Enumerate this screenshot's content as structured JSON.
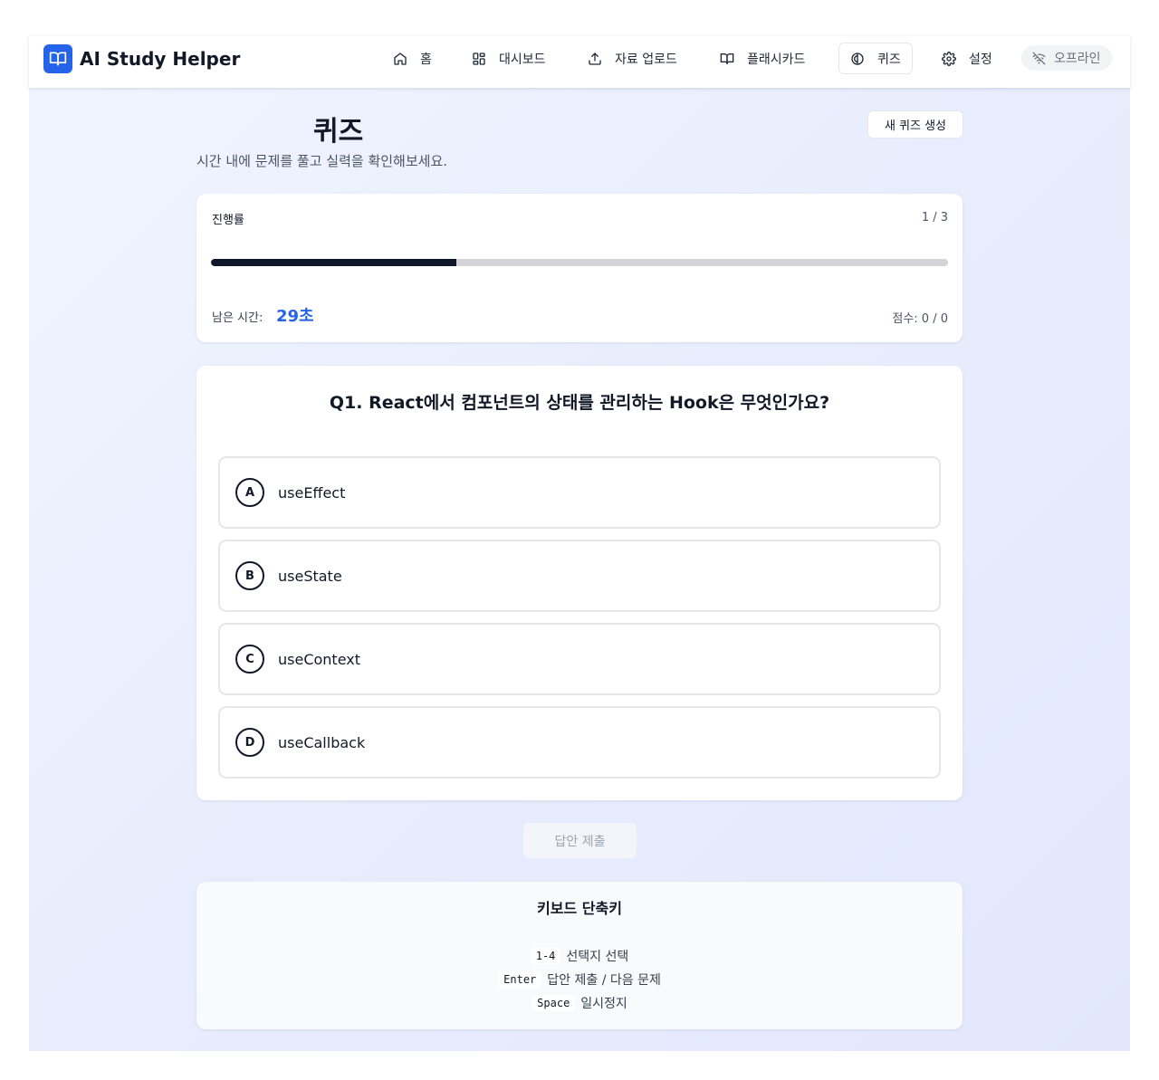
{
  "header": {
    "app_name": "AI Study Helper",
    "nav": [
      {
        "label": "홈",
        "icon": "home-icon"
      },
      {
        "label": "대시보드",
        "icon": "dashboard-grid-icon"
      },
      {
        "label": "자료 업로드",
        "icon": "upload-icon"
      },
      {
        "label": "플래시카드",
        "icon": "book-open-icon"
      },
      {
        "label": "퀴즈",
        "icon": "quiz-icon",
        "active": true
      },
      {
        "label": "설정",
        "icon": "gear-icon"
      }
    ],
    "status_label": "오프라인",
    "status_icon": "wifi-off-icon"
  },
  "page": {
    "title": "퀴즈",
    "subtitle": "시간 내에 문제를 풀고 실력을 확인해보세요.",
    "new_quiz_button": "새 퀴즈 생성"
  },
  "progress": {
    "label": "진행률",
    "count": "1 / 3",
    "fraction": 0.333,
    "time_label": "남은 시간:",
    "time_value": "29초",
    "score": "점수: 0 / 0"
  },
  "question": {
    "text": "Q1. React에서 컴포넌트의 상태를 관리하는 Hook은 무엇인가요?",
    "options": [
      {
        "letter": "A",
        "text": "useEffect"
      },
      {
        "letter": "B",
        "text": "useState"
      },
      {
        "letter": "C",
        "text": "useContext"
      },
      {
        "letter": "D",
        "text": "useCallback"
      }
    ]
  },
  "submit_button": "답안 제출",
  "shortcuts": {
    "title": "키보드 단축키",
    "items": [
      {
        "key": "1-4",
        "desc": "선택지 선택"
      },
      {
        "key": "Enter",
        "desc": "답안 제출 / 다음 문제"
      },
      {
        "key": "Space",
        "desc": "일시정지"
      }
    ]
  },
  "colors": {
    "accent": "#2563eb",
    "progress_fill": "#0f172a",
    "progress_track": "#d4d4d8"
  }
}
